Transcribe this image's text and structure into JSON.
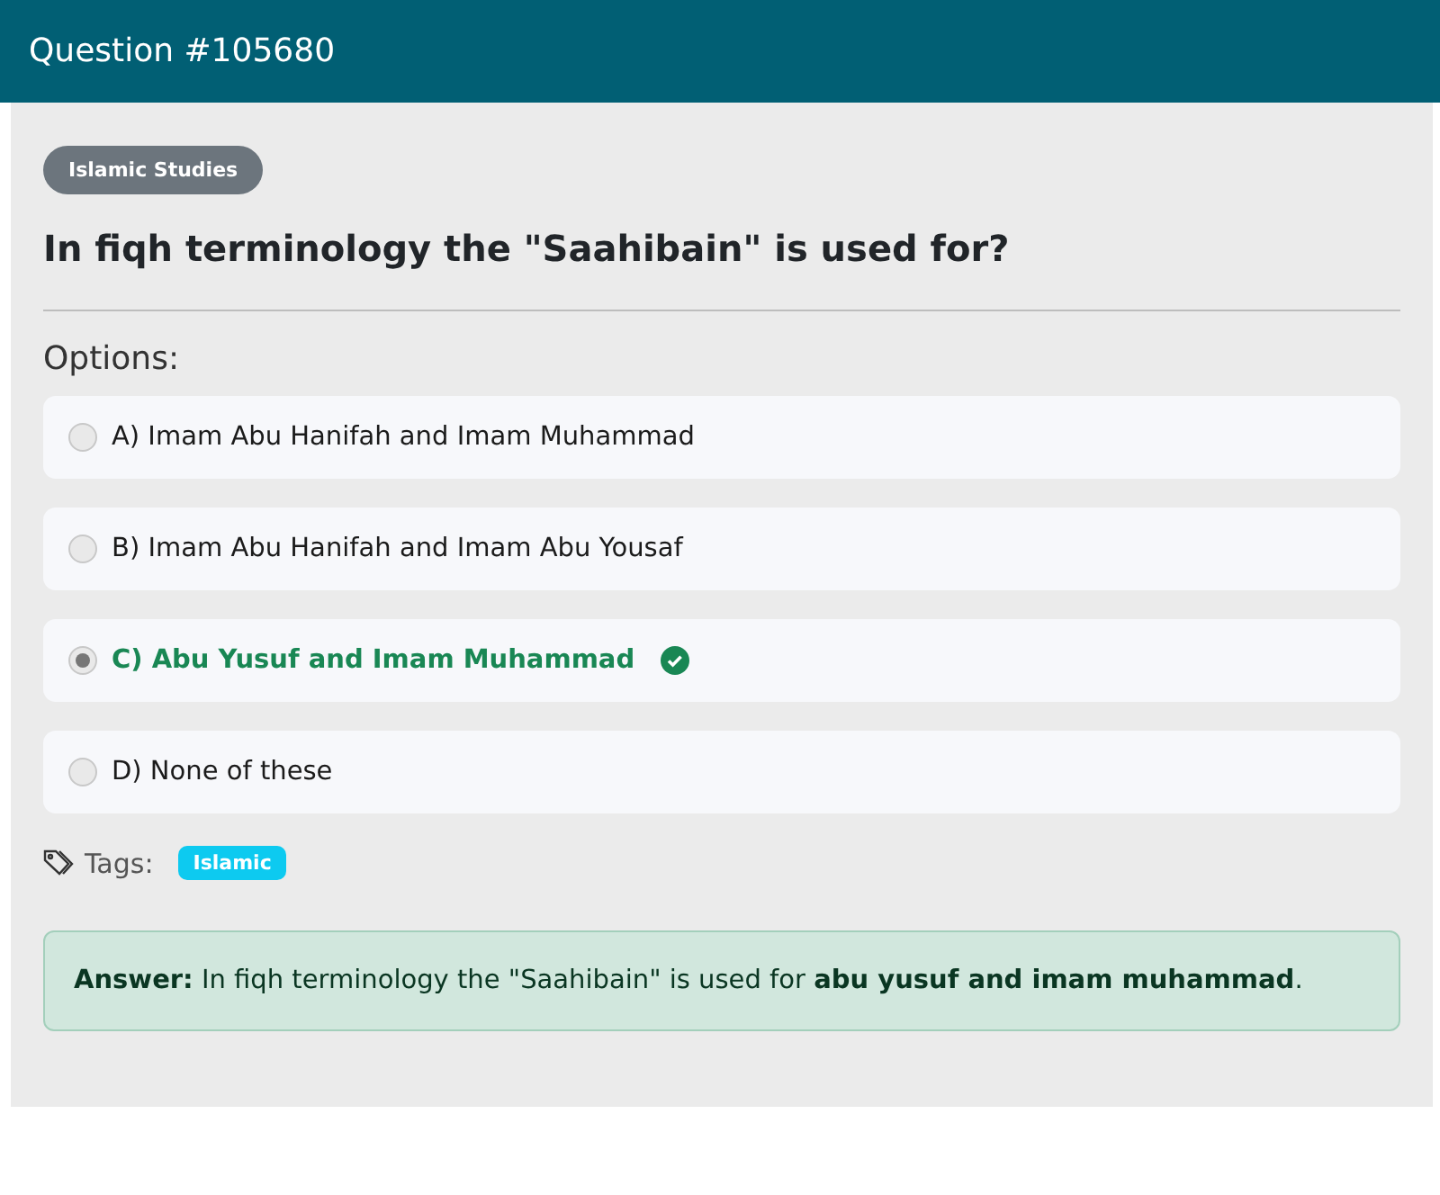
{
  "header": {
    "title": "Question #105680"
  },
  "category": "Islamic Studies",
  "question": "In fiqh terminology the \"Saahibain\" is used for?",
  "options_label": "Options:",
  "options": [
    {
      "text": "A) Imam Abu Hanifah and Imam Muhammad",
      "selected": false,
      "correct": false
    },
    {
      "text": "B) Imam Abu Hanifah and Imam Abu Yousaf",
      "selected": false,
      "correct": false
    },
    {
      "text": "C) Abu Yusuf and Imam Muhammad",
      "selected": true,
      "correct": true
    },
    {
      "text": "D) None of these",
      "selected": false,
      "correct": false
    }
  ],
  "tags_label": "Tags:",
  "tags": [
    "Islamic"
  ],
  "answer": "**Answer:** In fiqh terminology the \"Saahibain\" is used for **abu yusuf and imam muhammad**."
}
